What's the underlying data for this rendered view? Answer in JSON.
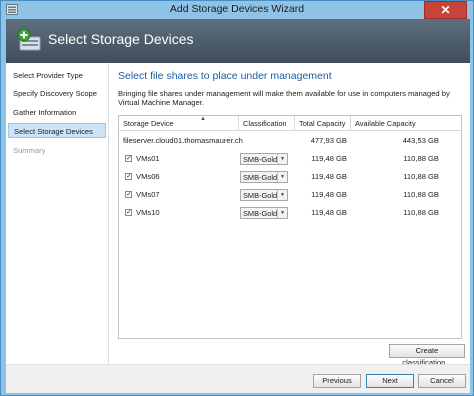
{
  "window": {
    "title": "Add Storage Devices Wizard",
    "close_label": "✕"
  },
  "header": {
    "title": "Select Storage Devices"
  },
  "nav": {
    "items": [
      {
        "label": "Select Provider Type",
        "state": "normal"
      },
      {
        "label": "Specify Discovery Scope",
        "state": "normal"
      },
      {
        "label": "Gather Information",
        "state": "normal"
      },
      {
        "label": "Select Storage Devices",
        "state": "active"
      },
      {
        "label": "Summary",
        "state": "disabled"
      }
    ]
  },
  "main": {
    "heading": "Select file shares to place under management",
    "description": "Bringing file shares under management will make them available for use in computers managed by Virtual Machine Manager."
  },
  "grid": {
    "columns": [
      "Storage Device",
      "Classification",
      "Total Capacity",
      "Available Capacity"
    ],
    "server": {
      "name": "fileserver.cloud01.thomasmaurer.ch",
      "total": "477,93 GB",
      "available": "443,53 GB"
    },
    "shares": [
      {
        "name": "VMs01",
        "checked": true,
        "classification": "SMB-Gold",
        "total": "119,48 GB",
        "available": "110,88 GB"
      },
      {
        "name": "VMs06",
        "checked": true,
        "classification": "SMB-Gold",
        "total": "119,48 GB",
        "available": "110,88 GB"
      },
      {
        "name": "VMs07",
        "checked": true,
        "classification": "SMB-Gold",
        "total": "119,48 GB",
        "available": "110,88 GB"
      },
      {
        "name": "VMs10",
        "checked": true,
        "classification": "SMB-Gold",
        "total": "119,48 GB",
        "available": "110,88 GB"
      }
    ],
    "checkmark": "✓",
    "dropdown_glyph": "▼",
    "sort_glyph": "▲"
  },
  "buttons": {
    "create_classification": "Create classification...",
    "previous": "Previous",
    "next": "Next",
    "cancel": "Cancel"
  }
}
